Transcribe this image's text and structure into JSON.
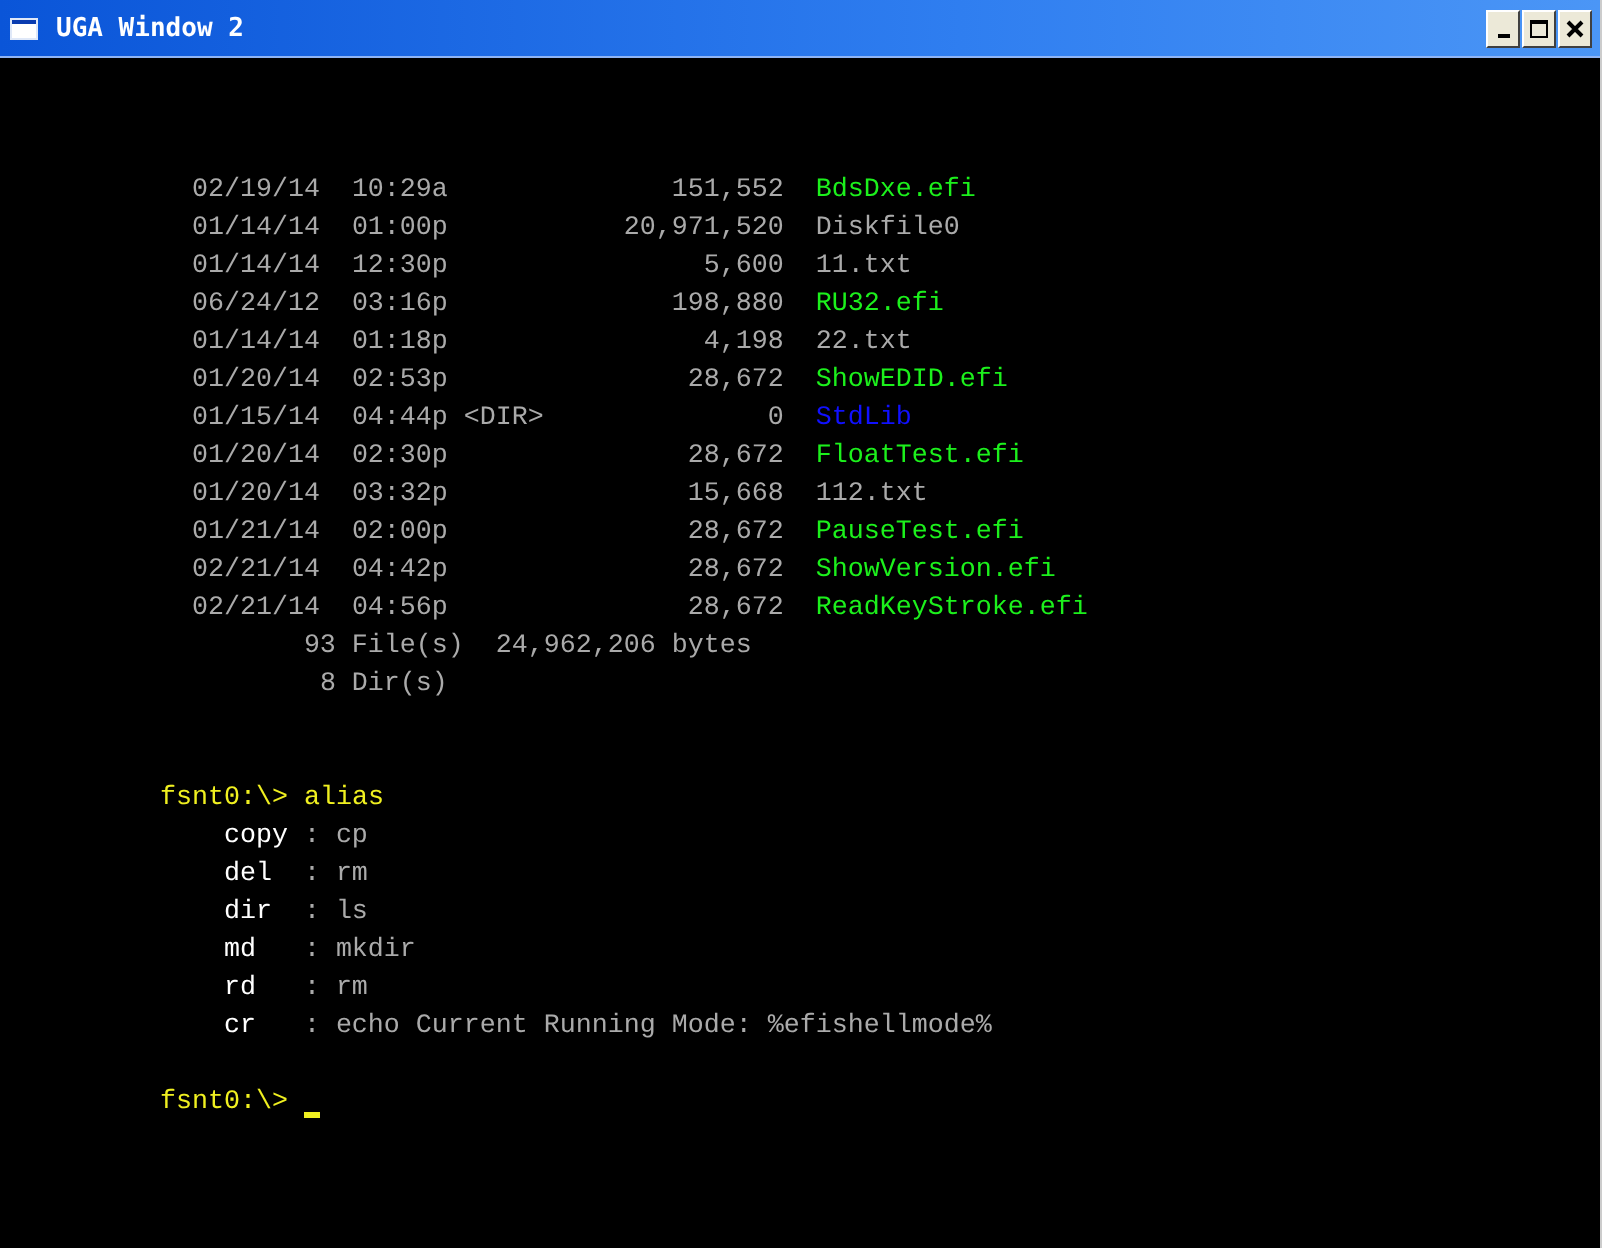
{
  "window": {
    "title": "UGA Window 2",
    "buttons": [
      {
        "kind": "minimize"
      },
      {
        "kind": "maximize"
      },
      {
        "kind": "close"
      }
    ]
  },
  "listing": [
    {
      "date": "02/19/14",
      "time": "10:29a",
      "size": "151,552",
      "name": "BdsDxe.efi",
      "kind": "executable"
    },
    {
      "date": "01/14/14",
      "time": "01:00p",
      "size": "20,971,520",
      "name": "Diskfile0",
      "kind": "file"
    },
    {
      "date": "01/14/14",
      "time": "12:30p",
      "size": "5,600",
      "name": "11.txt",
      "kind": "file"
    },
    {
      "date": "06/24/12",
      "time": "03:16p",
      "size": "198,880",
      "name": "RU32.efi",
      "kind": "executable"
    },
    {
      "date": "01/14/14",
      "time": "01:18p",
      "size": "4,198",
      "name": "22.txt",
      "kind": "file"
    },
    {
      "date": "01/20/14",
      "time": "02:53p",
      "size": "28,672",
      "name": "ShowEDID.efi",
      "kind": "executable"
    },
    {
      "date": "01/15/14",
      "time": "04:44p",
      "dir_tag": "<DIR>",
      "size": "0",
      "name": "StdLib",
      "kind": "directory"
    },
    {
      "date": "01/20/14",
      "time": "02:30p",
      "size": "28,672",
      "name": "FloatTest.efi",
      "kind": "executable"
    },
    {
      "date": "01/20/14",
      "time": "03:32p",
      "size": "15,668",
      "name": "112.txt",
      "kind": "file"
    },
    {
      "date": "01/21/14",
      "time": "02:00p",
      "size": "28,672",
      "name": "PauseTest.efi",
      "kind": "executable"
    },
    {
      "date": "02/21/14",
      "time": "04:42p",
      "size": "28,672",
      "name": "ShowVersion.efi",
      "kind": "executable"
    },
    {
      "date": "02/21/14",
      "time": "04:56p",
      "size": "28,672",
      "name": "ReadKeyStroke.efi",
      "kind": "executable"
    }
  ],
  "summary": [
    {
      "count": "93",
      "label": "File(s)",
      "total": "24,962,206 bytes"
    },
    {
      "count": "8",
      "label": "Dir(s)"
    }
  ],
  "alias_command": {
    "prompt": "fsnt0:\\>",
    "command": "alias"
  },
  "aliases": [
    {
      "name": "copy",
      "separator": ":",
      "value": "cp"
    },
    {
      "name": "del",
      "separator": ":",
      "value": "rm"
    },
    {
      "name": "dir",
      "separator": ":",
      "value": "ls"
    },
    {
      "name": "md",
      "separator": ":",
      "value": "mkdir"
    },
    {
      "name": "rd",
      "separator": ":",
      "value": "rm"
    },
    {
      "name": "cr",
      "separator": ":",
      "value": "echo Current Running Mode: %efishellmode%"
    }
  ],
  "final_prompt": {
    "prompt": "fsnt0:\\>",
    "cursor": true
  }
}
